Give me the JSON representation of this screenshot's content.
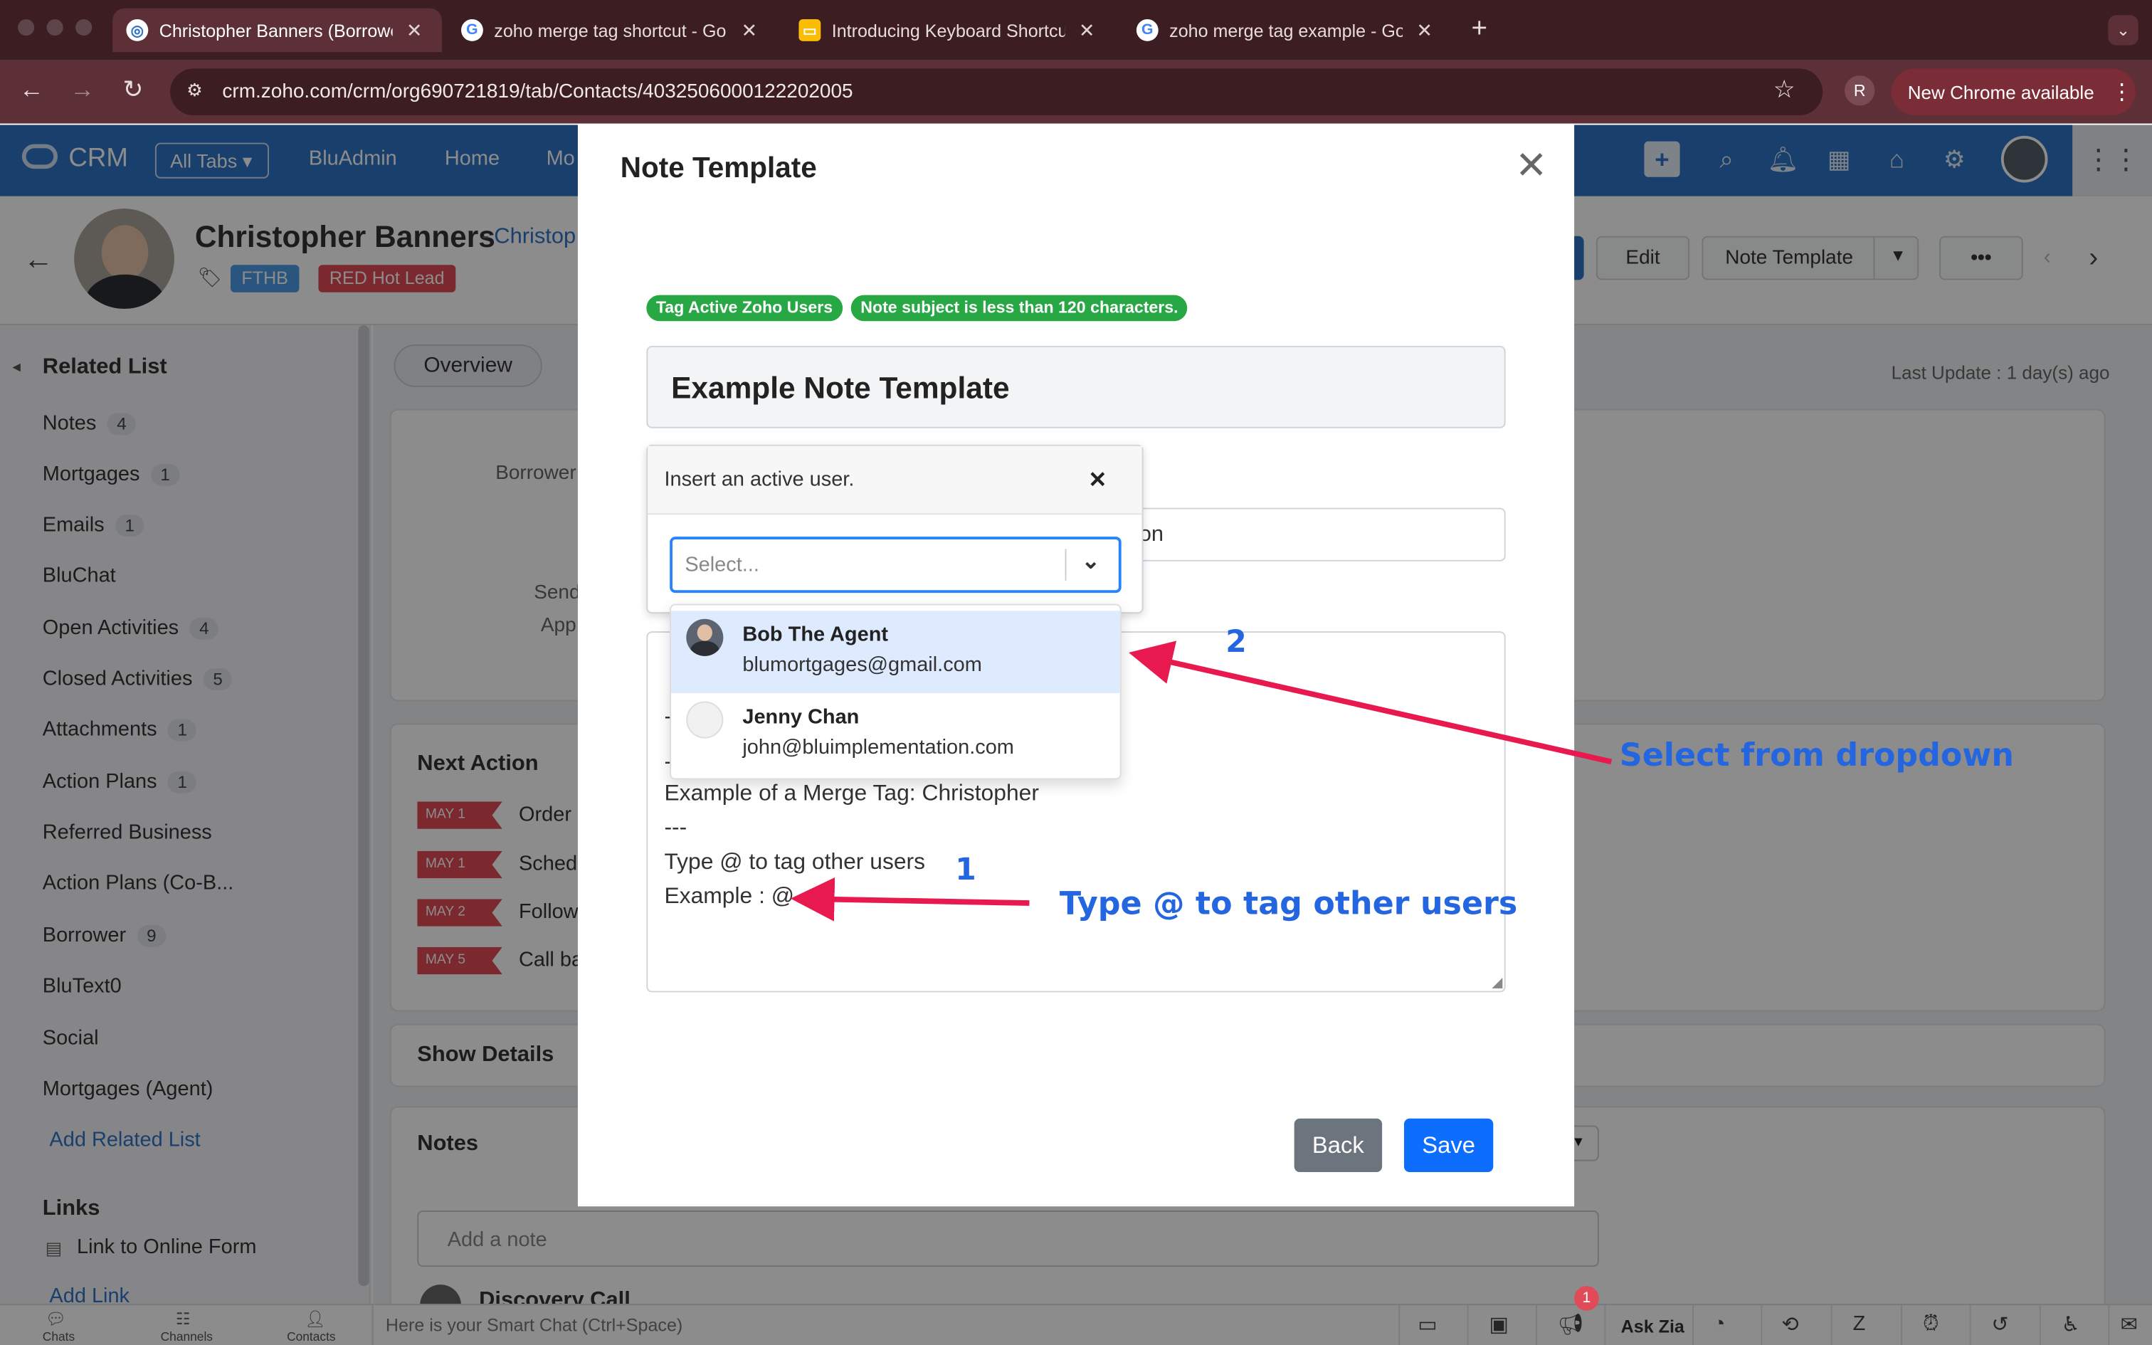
{
  "browser": {
    "tabs": [
      {
        "title": "Christopher Banners (Borrower",
        "icon": "zoho-icon",
        "active": true
      },
      {
        "title": "zoho merge tag shortcut - Go",
        "icon": "google-icon"
      },
      {
        "title": "Introducing Keyboard Shortcu",
        "icon": "slides-icon"
      },
      {
        "title": "zoho merge tag example - Go",
        "icon": "google-icon"
      }
    ],
    "url": "crm.zoho.com/crm/org690721819/tab/Contacts/4032506000122202005",
    "profile_initial": "R",
    "new_chrome": "New Chrome available"
  },
  "crm_header": {
    "logo": "CRM",
    "all_tabs": "All Tabs",
    "nav": [
      "BluAdmin",
      "Home",
      "Mo"
    ]
  },
  "contact": {
    "name": "Christopher Banners",
    "subtitle": "Christop",
    "tags": [
      "FTHB",
      "RED Hot Lead"
    ],
    "edit": "Edit",
    "note_template": "Note Template",
    "more": "•••"
  },
  "sidebar": {
    "title": "Related List",
    "items": [
      {
        "label": "Notes",
        "count": "4"
      },
      {
        "label": "Mortgages",
        "count": "1"
      },
      {
        "label": "Emails",
        "count": "1"
      },
      {
        "label": "BluChat",
        "count": ""
      },
      {
        "label": "Open Activities",
        "count": "4"
      },
      {
        "label": "Closed Activities",
        "count": "5"
      },
      {
        "label": "Attachments",
        "count": "1"
      },
      {
        "label": "Action Plans",
        "count": "1"
      },
      {
        "label": "Referred Business",
        "count": ""
      },
      {
        "label": "Action Plans (Co-B...",
        "count": ""
      },
      {
        "label": "Borrower",
        "count": "9"
      },
      {
        "label": "BluText0",
        "count": ""
      },
      {
        "label": "Social",
        "count": ""
      },
      {
        "label": "Mortgages (Agent)",
        "count": ""
      }
    ],
    "add_related": "Add Related List",
    "links_title": "Links",
    "link_item": "Link to Online Form",
    "add_link": "Add Link"
  },
  "main": {
    "overview_tab": "Overview",
    "last_update": "Last Update : 1 day(s) ago",
    "field_labels": [
      "Borrower",
      "Send",
      "App"
    ],
    "next_action_title": "Next Action",
    "actions": [
      {
        "date": "MAY 1",
        "text": "Order"
      },
      {
        "date": "MAY 1",
        "text": "Sched"
      },
      {
        "date": "MAY 2",
        "text": "Follow"
      },
      {
        "date": "MAY 5",
        "text": "Call ba"
      }
    ],
    "show_details": "Show Details",
    "notes_title": "Notes",
    "add_note_placeholder": "Add a note",
    "discovery": "Discovery Call"
  },
  "bottom": {
    "chats": "Chats",
    "channels": "Channels",
    "contacts": "Contacts",
    "smart_chat": "Here is your Smart Chat (Ctrl+Space)",
    "ask_zia": "Ask Zia",
    "notif_count": "1"
  },
  "modal": {
    "title": "Note Template",
    "badges": [
      "Tag Active Zoho Users",
      "Note subject is less than 120 characters."
    ],
    "subject": "Example Note Template",
    "field2_value": "on",
    "body_lines": [
      "-",
      "-",
      "Example of a Merge Tag: Christopher",
      "---",
      "Type @ to tag other users",
      "Example : @"
    ],
    "back": "Back",
    "save": "Save"
  },
  "popup": {
    "title": "Insert an active user.",
    "select_placeholder": "Select...",
    "options": [
      {
        "name": "Bob The Agent",
        "email": "blumortgages@gmail.com",
        "highlighted": true
      },
      {
        "name": "Jenny Chan",
        "email": "john@bluimplementation.com",
        "highlighted": false
      }
    ]
  },
  "annotations": {
    "num1": "1",
    "num2": "2",
    "label1": "Type @ to tag other users",
    "label2": "Select from dropdown",
    "color": "#2466e0",
    "arrow_color": "#e8194f"
  }
}
